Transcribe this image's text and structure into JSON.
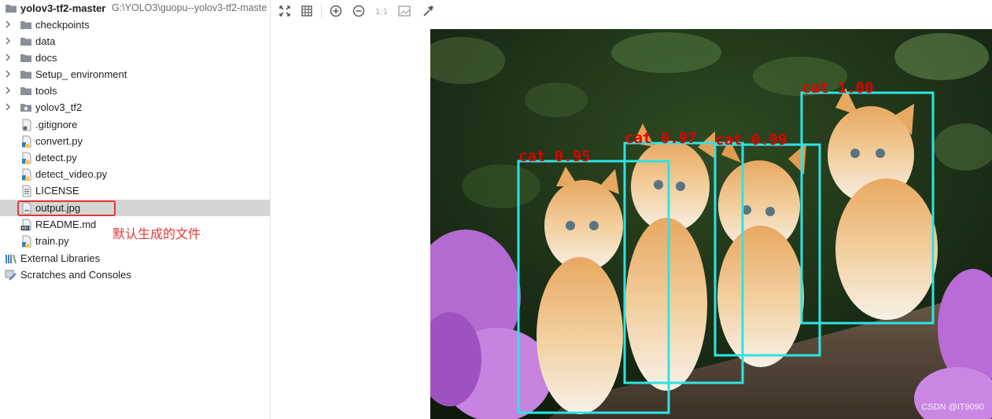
{
  "project": {
    "root_name": "yolov3-tf2-master",
    "root_path": "G:\\YOLO3\\guopu--yolov3-tf2-maste",
    "folders": [
      "checkpoints",
      "data",
      "docs",
      "Setup_ environment",
      "tools",
      "yolov3_tf2"
    ],
    "files": [
      ".gitignore",
      "convert.py",
      "detect.py",
      "detect_video.py",
      "LICENSE",
      "output.jpg",
      "README.md",
      "train.py"
    ],
    "external_libraries": "External Libraries",
    "scratches": "Scratches and Consoles"
  },
  "annotation": "默认生成的文件",
  "viewer": {
    "zoom_actual": "1:1",
    "detections": [
      {
        "label": "cat 0.95",
        "class": "cat",
        "score": 0.95
      },
      {
        "label": "cat 0.97",
        "class": "cat",
        "score": 0.97
      },
      {
        "label": "cat 0.99",
        "class": "cat",
        "score": 0.99
      },
      {
        "label": "cat 1.00",
        "class": "cat",
        "score": 1.0
      }
    ],
    "watermark": "CSDN @IT9090"
  },
  "colors": {
    "box": "#2fe3e3",
    "detection_text": "#e00000",
    "highlight": "#e53935",
    "selection": "#d5d5d5"
  }
}
